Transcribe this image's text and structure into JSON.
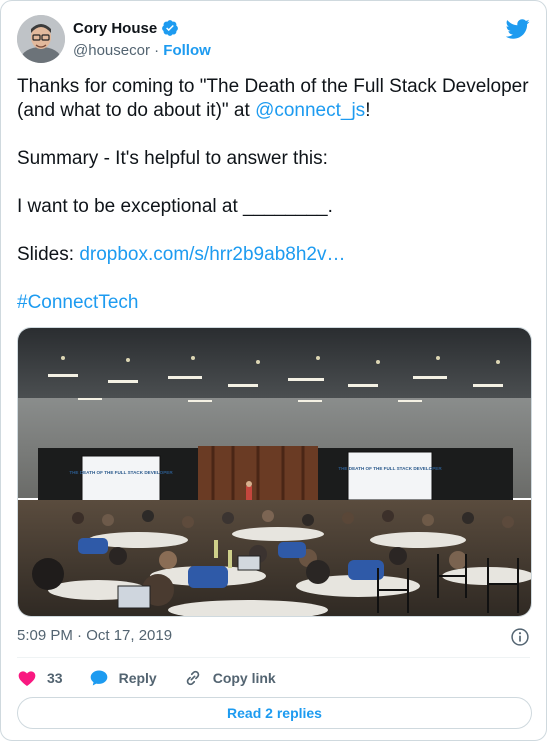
{
  "author": {
    "name": "Cory House",
    "handle": "@housecor",
    "separator": "·",
    "follow_label": "Follow"
  },
  "tweet": {
    "line1_pre": "Thanks for coming to \"The Death of the Full Stack Developer (and what to do about it)\" at ",
    "mention": "@connect_js",
    "line1_post": "!",
    "summary": "Summary - It's helpful to answer this:",
    "blank": "I want to be exceptional at ________.",
    "slides_label": "Slides: ",
    "slides_link": "dropbox.com/s/hrr2b9ab8h2v…",
    "hashtag": "#ConnectTech"
  },
  "media": {
    "slide_left_title": "THE DEATH OF THE FULL STACK DEVELOPER",
    "slide_right_title": "THE DEATH OF THE FULL STACK DEVELOPER"
  },
  "meta": {
    "timestamp": "5:09 PM · Oct 17, 2019"
  },
  "actions": {
    "like_count": "33",
    "reply_label": "Reply",
    "copy_label": "Copy link",
    "read_replies_label": "Read 2 replies"
  },
  "colors": {
    "accent": "#1d9bf0",
    "like": "#f91880",
    "text": "#0f1419",
    "muted": "#536471"
  },
  "icons": [
    "verified-badge-icon",
    "twitter-bird-icon",
    "info-icon",
    "heart-icon",
    "reply-bubble-icon",
    "link-icon"
  ]
}
